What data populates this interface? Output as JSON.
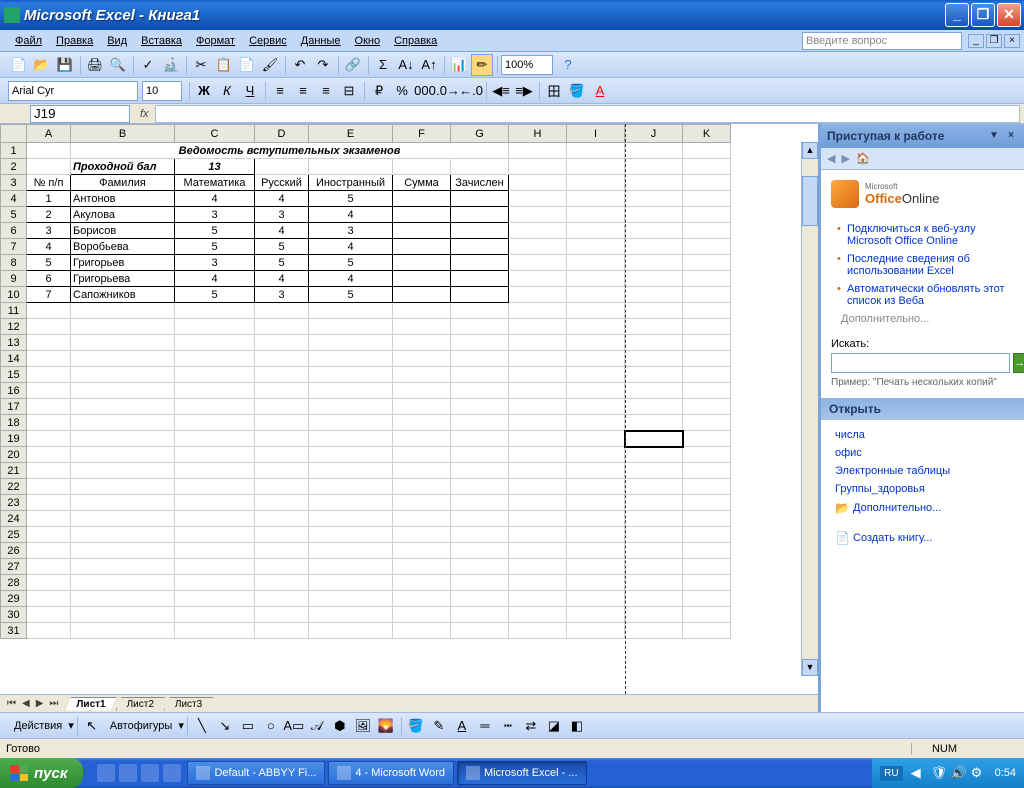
{
  "window": {
    "title": "Microsoft Excel - Книга1"
  },
  "menu": {
    "file": "Файл",
    "edit": "Правка",
    "view": "Вид",
    "insert": "Вставка",
    "format": "Формат",
    "tools": "Сервис",
    "data": "Данные",
    "window": "Окно",
    "help": "Справка",
    "help_placeholder": "Введите вопрос"
  },
  "toolbar": {
    "zoom": "100%",
    "font": "Arial Cyr",
    "size": "10"
  },
  "formula": {
    "namebox": "J19",
    "value": ""
  },
  "columns": [
    "A",
    "B",
    "C",
    "D",
    "E",
    "F",
    "G",
    "H",
    "I",
    "J",
    "K"
  ],
  "rows": 31,
  "sheet": {
    "title": "Ведомость вступительных экзаменов",
    "pass_label": "Проходной бал",
    "pass_value": "13",
    "headers": [
      "№ п/п",
      "Фамилия",
      "Математика",
      "Русский",
      "Иностранный",
      "Сумма",
      "Зачислен"
    ],
    "data": [
      [
        "1",
        "Антонов",
        "4",
        "4",
        "5",
        "",
        ""
      ],
      [
        "2",
        "Акулова",
        "3",
        "3",
        "4",
        "",
        ""
      ],
      [
        "3",
        "Борисов",
        "5",
        "4",
        "3",
        "",
        ""
      ],
      [
        "4",
        "Воробьева",
        "5",
        "5",
        "4",
        "",
        ""
      ],
      [
        "5",
        "Григорьев",
        "3",
        "5",
        "5",
        "",
        ""
      ],
      [
        "6",
        "Григорьева",
        "4",
        "4",
        "4",
        "",
        ""
      ],
      [
        "7",
        "Сапожников",
        "5",
        "3",
        "5",
        "",
        ""
      ]
    ]
  },
  "sheets": [
    "Лист1",
    "Лист2",
    "Лист3"
  ],
  "taskpane": {
    "title": "Приступая к работе",
    "office_ms": "Microsoft",
    "office_brand": "Office",
    "office_online": "Online",
    "links": [
      "Подключиться к веб-узлу Microsoft Office Online",
      "Последние сведения об использовании Excel",
      "Автоматически обновлять этот список из Веба"
    ],
    "more": "Дополнительно...",
    "search_label": "Искать:",
    "example": "Пример: \"Печать нескольких копий\"",
    "open_section": "Открыть",
    "recent": [
      "числа",
      "офис",
      "Электронные таблицы",
      "Группы_здоровья"
    ],
    "open_more": "Дополнительно...",
    "create": "Создать книгу..."
  },
  "drawbar": {
    "actions": "Действия",
    "autoshapes": "Автофигуры"
  },
  "status": {
    "ready": "Готово",
    "num": "NUM"
  },
  "taskbar": {
    "start": "пуск",
    "tasks": [
      "Default - ABBYY Fi...",
      "4 - Microsoft Word",
      "Microsoft Excel - ..."
    ],
    "lang": "RU",
    "time": "0:54"
  },
  "colors": {
    "title_blue": "#1658c8",
    "toolbar_blue": "#c4d8f8",
    "accent_orange": "#d86a10"
  }
}
